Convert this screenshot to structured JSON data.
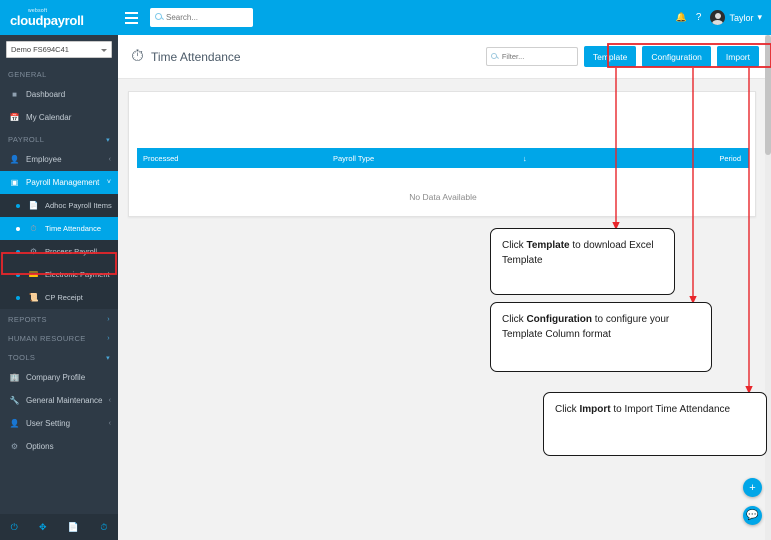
{
  "topbar": {
    "logo_small": "websoft",
    "logo_main": "cloudpayroll",
    "menu_icon": "hamburger-icon",
    "search_placeholder": "Search...",
    "bell_icon": "bell-icon",
    "help_icon": "question-mark-icon",
    "user_name": "Taylor",
    "user_caret": "▾"
  },
  "sidebar": {
    "company": "Demo FS694C41",
    "sections": [
      {
        "label": "GENERAL",
        "collapse": "",
        "items": [
          {
            "label": "Dashboard",
            "icon": "dashboard-icon",
            "chev": "",
            "sub": false,
            "active": false
          },
          {
            "label": "My Calendar",
            "icon": "calendar-icon",
            "chev": "",
            "sub": false,
            "active": false
          }
        ]
      },
      {
        "label": "PAYROLL",
        "collapse": "▾",
        "items": [
          {
            "label": "Employee",
            "icon": "user-icon",
            "chev": "‹",
            "sub": false,
            "active": false
          },
          {
            "label": "Payroll Management",
            "icon": "payroll-icon",
            "chev": "˅",
            "sub": false,
            "active": true
          },
          {
            "label": "Adhoc Payroll Items",
            "icon": "file-icon",
            "chev": "",
            "sub": true,
            "active": false
          },
          {
            "label": "Time Attendance",
            "icon": "clock-icon",
            "chev": "",
            "sub": true,
            "active": false,
            "selected": true
          },
          {
            "label": "Process Payroll",
            "icon": "gear-icon",
            "chev": "",
            "sub": true,
            "active": false
          },
          {
            "label": "Electronic Payment",
            "icon": "card-icon",
            "chev": "",
            "sub": true,
            "active": false
          },
          {
            "label": "CP Receipt",
            "icon": "receipt-icon",
            "chev": "",
            "sub": true,
            "active": false
          }
        ]
      },
      {
        "label": "REPORTS",
        "collapse": "›",
        "items": []
      },
      {
        "label": "HUMAN RESOURCE",
        "collapse": "›",
        "items": []
      },
      {
        "label": "TOOLS",
        "collapse": "▾",
        "items": [
          {
            "label": "Company Profile",
            "icon": "building-icon",
            "chev": "",
            "sub": false,
            "active": false
          },
          {
            "label": "General Maintenance",
            "icon": "wrench-icon",
            "chev": "‹",
            "sub": false,
            "active": false
          },
          {
            "label": "User Setting",
            "icon": "user-setting-icon",
            "chev": "‹",
            "sub": false,
            "active": false
          },
          {
            "label": "Options",
            "icon": "options-icon",
            "chev": "",
            "sub": false,
            "active": false
          }
        ]
      }
    ],
    "bottom_icons": [
      "power-icon",
      "expand-icon",
      "copy-icon",
      "clock-history-icon"
    ]
  },
  "page": {
    "title": "Time Attendance",
    "title_icon": "clock-icon",
    "filter_placeholder": "Filter...",
    "buttons": [
      {
        "label": "Template",
        "name": "template-button"
      },
      {
        "label": "Configuration",
        "name": "configuration-button"
      },
      {
        "label": "Import",
        "name": "import-button"
      }
    ]
  },
  "table": {
    "columns": [
      "Processed",
      "Payroll Type",
      "↓",
      "Period"
    ],
    "empty_message": "No Data Available"
  },
  "callouts": [
    {
      "pre": "Click ",
      "bold": "Template",
      "post": " to download Excel Template"
    },
    {
      "pre": "Click ",
      "bold": "Configuration",
      "post": " to configure your Template Column format"
    },
    {
      "pre": "Click ",
      "bold": "Import",
      "post": " to Import Time Attendance"
    }
  ],
  "fab": {
    "add": "+",
    "chat": "💬"
  },
  "colors": {
    "accent": "#00a6e8",
    "sidebar": "#2e3a46",
    "annotation": "#e8262b"
  }
}
